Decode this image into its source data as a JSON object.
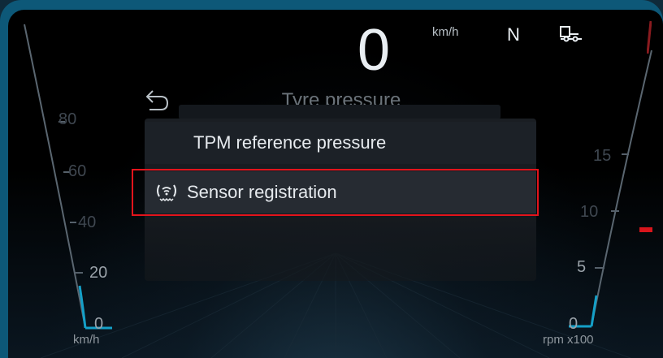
{
  "header": {
    "speed_value": "0",
    "speed_unit": "km/h",
    "gear": "N"
  },
  "icons": {
    "tow_icon": "trailer-tow-icon",
    "back_icon": "back-arrow-icon",
    "sensor_icon": "tyre-sensor-icon"
  },
  "menu": {
    "title": "Tyre pressure",
    "items": [
      {
        "label": "TPM reference pressure",
        "selected": false
      },
      {
        "label": "Sensor registration",
        "selected": true
      }
    ]
  },
  "speedometer": {
    "ticks": [
      "80",
      "60",
      "40",
      "20",
      "0"
    ],
    "unit": "km/h"
  },
  "tachometer": {
    "ticks": [
      "15",
      "10",
      "5",
      "0"
    ],
    "unit": "rpm x100"
  },
  "colors": {
    "accent_frame": "#0d5878",
    "highlight_border": "#e3141c",
    "text_primary": "#e6eaee"
  }
}
